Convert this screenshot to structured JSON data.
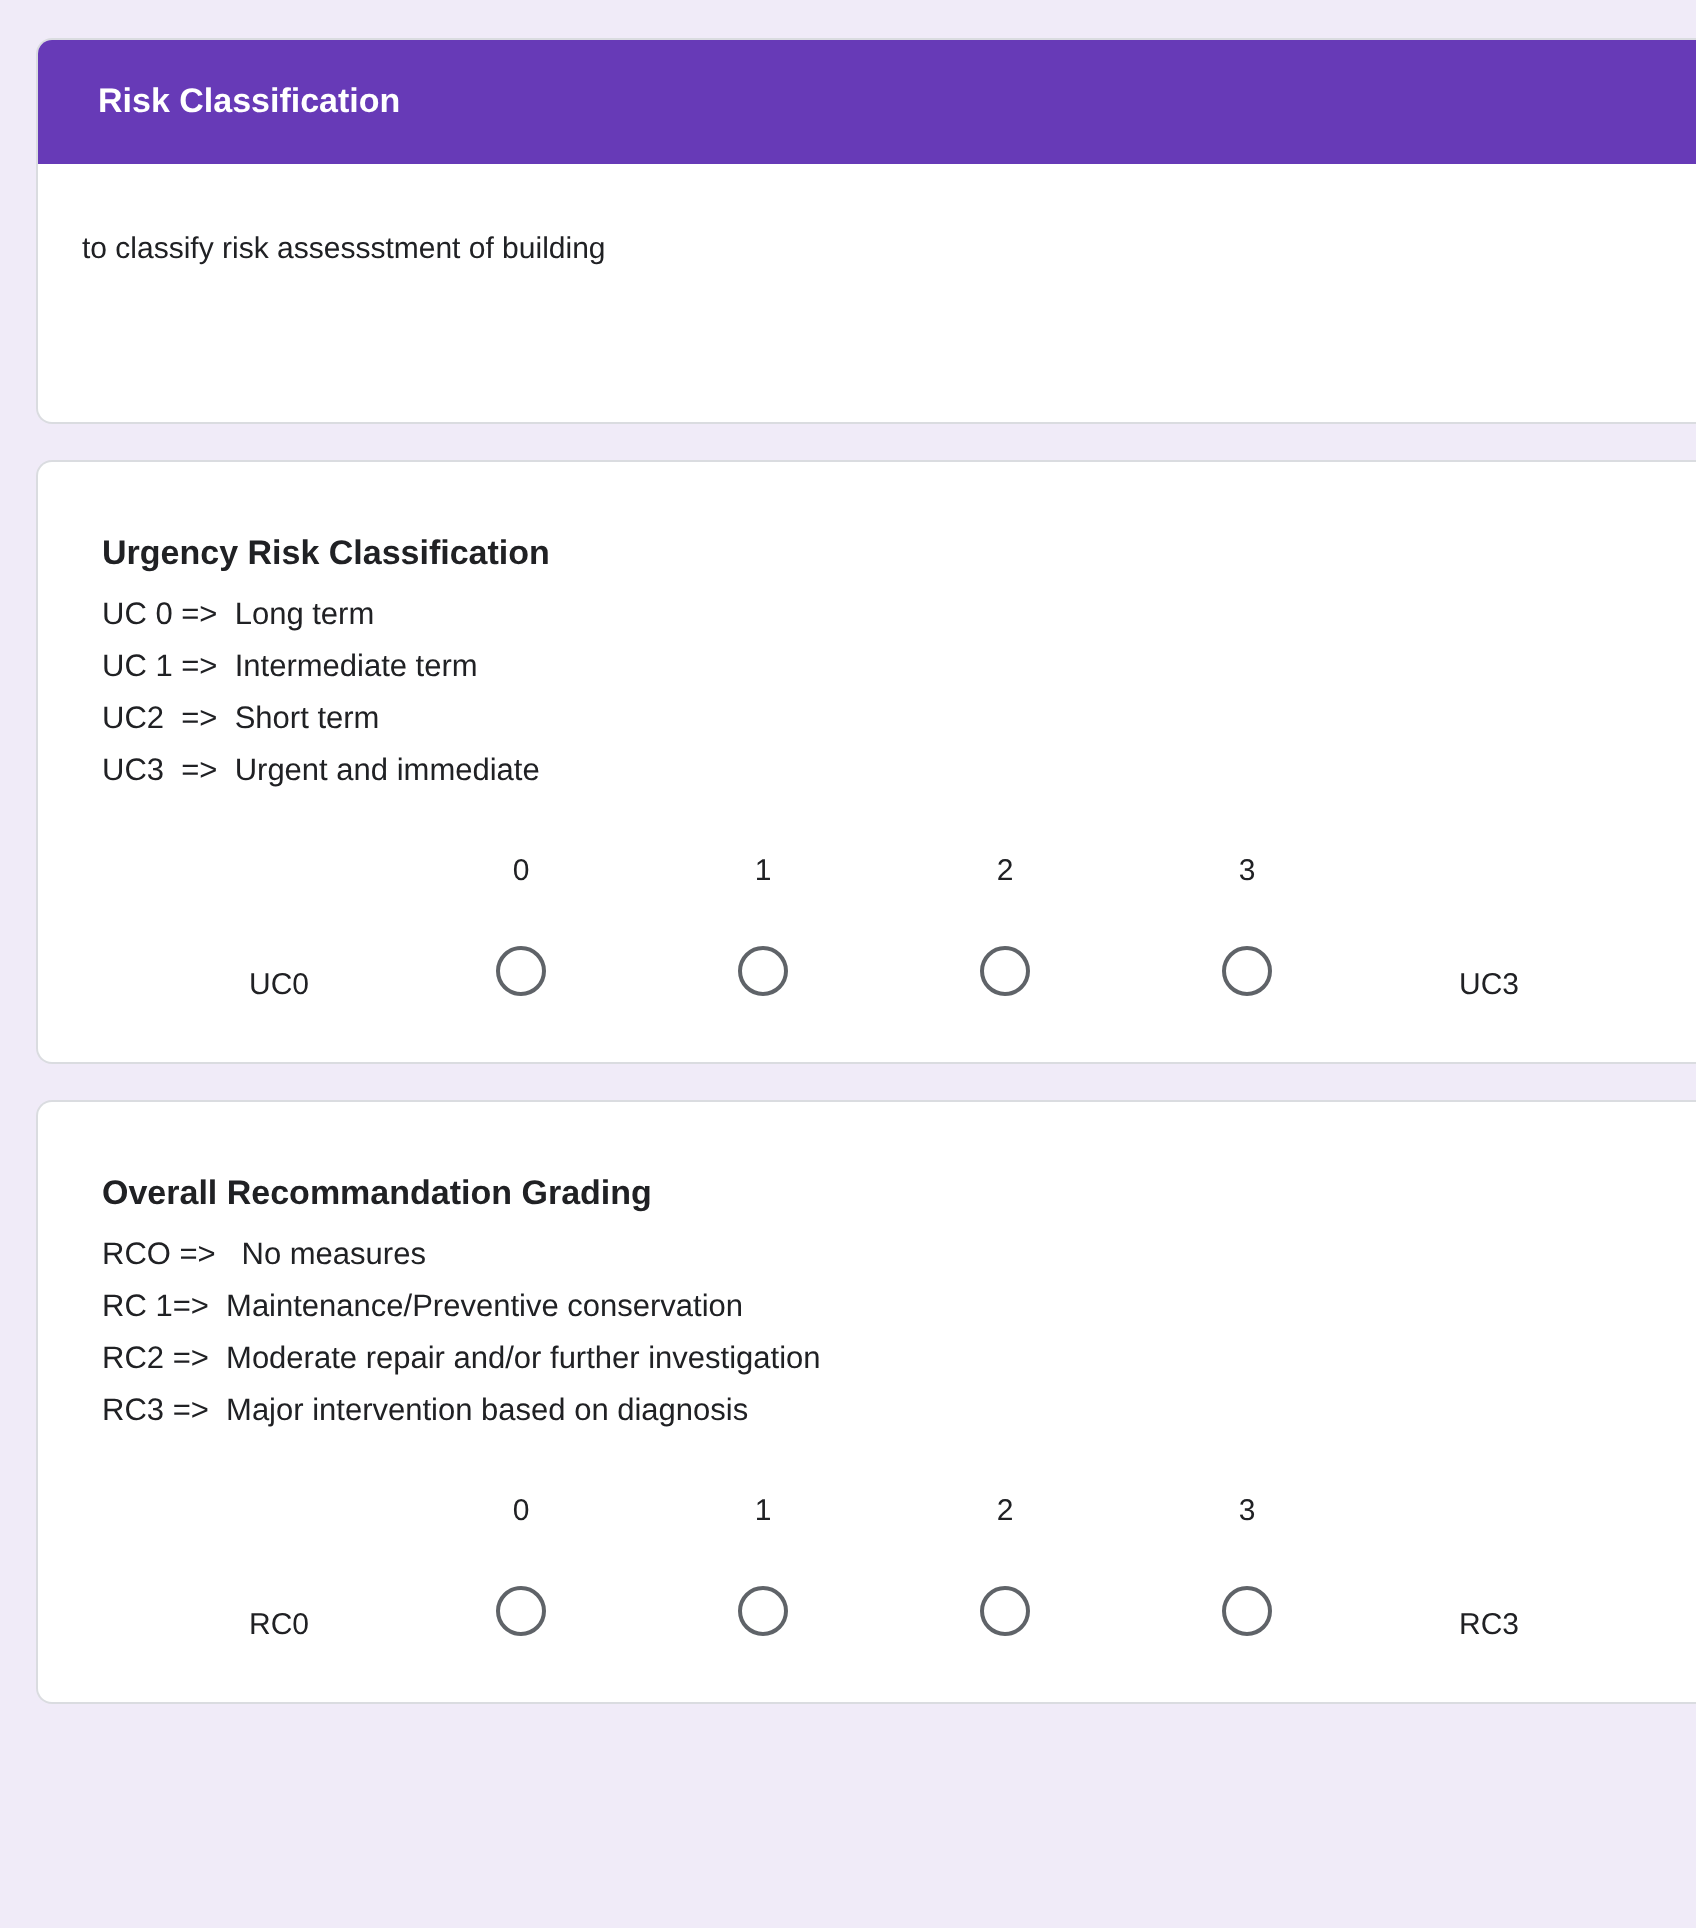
{
  "form": {
    "title": "Risk Classification",
    "description": "to classify risk assessstment of building"
  },
  "questions": [
    {
      "title": "Urgency Risk Classification",
      "lines": [
        "UC 0 =>  Long term",
        "UC 1 =>  Intermediate term",
        "UC2  =>  Short term",
        "UC3  =>  Urgent and immediate"
      ],
      "low_label": "UC0",
      "high_label": "UC3",
      "options": [
        {
          "label": "0",
          "selected": false
        },
        {
          "label": "1",
          "selected": false
        },
        {
          "label": "2",
          "selected": false
        },
        {
          "label": "3",
          "selected": false
        }
      ]
    },
    {
      "title": "Overall Recommandation Grading",
      "lines": [
        "RCO =>   No measures",
        "RC 1=>  Maintenance/Preventive conservation",
        "RC2 =>  Moderate repair and/or further investigation",
        "RC3 =>  Major intervention based on diagnosis"
      ],
      "low_label": "RC0",
      "high_label": "RC3",
      "options": [
        {
          "label": "0",
          "selected": false
        },
        {
          "label": "1",
          "selected": false
        },
        {
          "label": "2",
          "selected": false
        },
        {
          "label": "3",
          "selected": false
        }
      ]
    }
  ]
}
